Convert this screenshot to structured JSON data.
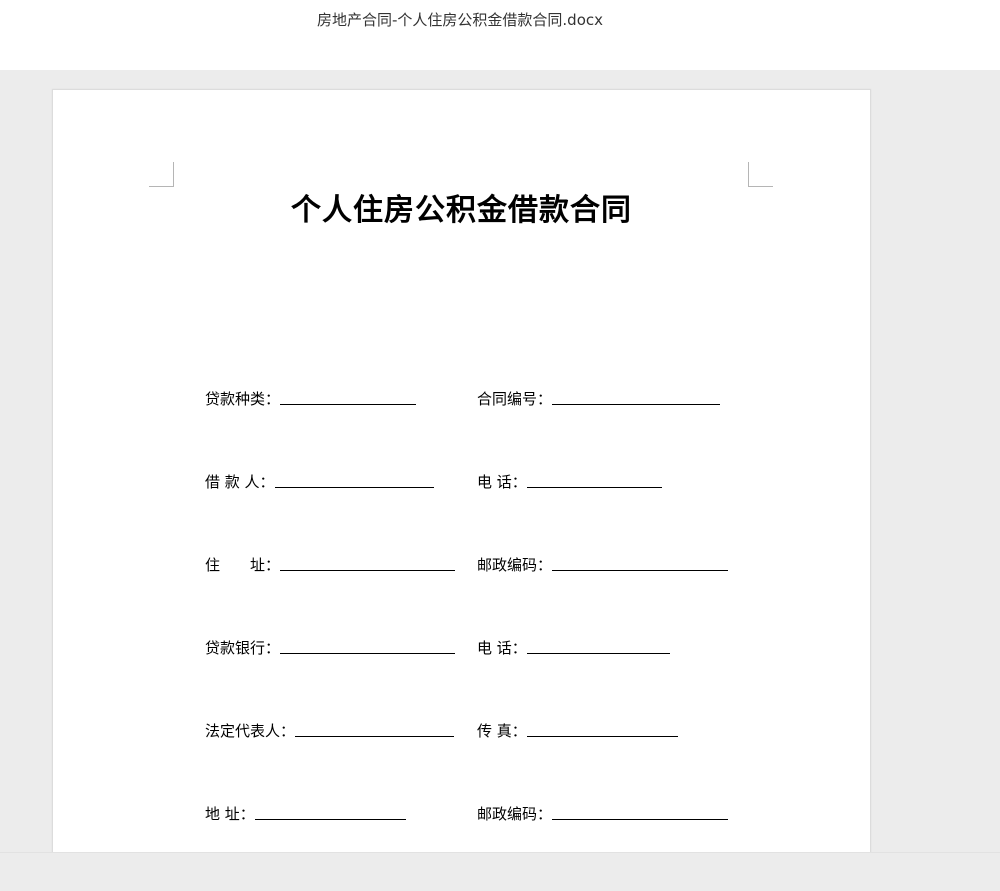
{
  "file": {
    "title": "房地产合同-个人住房公积金借款合同.docx"
  },
  "document": {
    "heading": "个人住房公积金借款合同",
    "rows": [
      {
        "left": {
          "label": "贷款种类："
        },
        "right": {
          "label": "合同编号："
        }
      },
      {
        "left": {
          "label": "借 款 人："
        },
        "right": {
          "label": "电 话："
        }
      },
      {
        "left": {
          "label": "住　　址："
        },
        "right": {
          "label": "邮政编码："
        }
      },
      {
        "left": {
          "label": "贷款银行："
        },
        "right": {
          "label": "电 话："
        }
      },
      {
        "left": {
          "label": "法定代表人："
        },
        "right": {
          "label": "传 真："
        }
      },
      {
        "left": {
          "label": "地 址："
        },
        "right": {
          "label": "邮政编码："
        }
      }
    ]
  }
}
